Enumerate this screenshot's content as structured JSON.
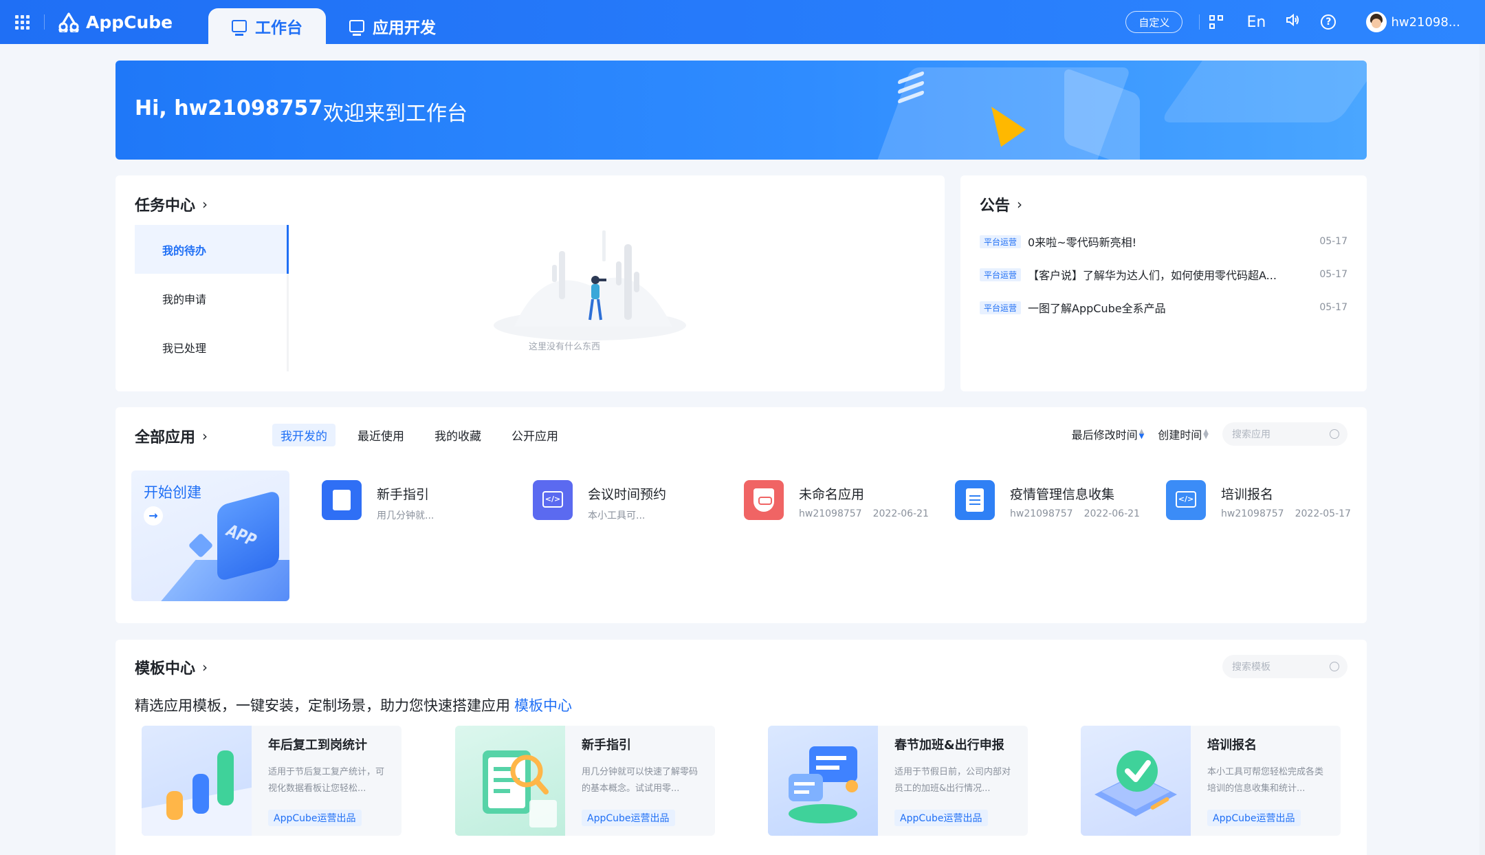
{
  "app": {
    "brand": "AppCube",
    "tabs": [
      {
        "label": "工作台",
        "active": true
      },
      {
        "label": "应用开发",
        "active": false
      }
    ],
    "customize_label": "自定义",
    "lang_label": "En",
    "user_name": "hw21098..."
  },
  "banner": {
    "greeting": "Hi, hw21098757",
    "welcome": "欢迎来到工作台"
  },
  "tasks": {
    "title": "任务中心",
    "nav": [
      "我的待办",
      "我的申请",
      "我已处理"
    ],
    "empty_text": "这里没有什么东西"
  },
  "notices": {
    "title": "公告",
    "items": [
      {
        "tag": "平台运营",
        "text": "0来啦~零代码新亮相!",
        "date": "05-17"
      },
      {
        "tag": "平台运营",
        "text": "【客户说】了解华为达人们，如何使用零代码超A...",
        "date": "05-17"
      },
      {
        "tag": "平台运营",
        "text": "一图了解AppCube全系产品",
        "date": "05-17"
      }
    ]
  },
  "apps": {
    "title": "全部应用",
    "tabs": [
      "我开发的",
      "最近使用",
      "我的收藏",
      "公开应用"
    ],
    "sort_modified": "最后修改时间",
    "sort_created": "创建时间",
    "search_placeholder": "搜索应用",
    "create_label": "开始创建",
    "create_deco_text": "APP",
    "items": [
      {
        "name": "新手指引",
        "sub1": "用几分钟就...",
        "sub2": "",
        "color": "#2f6ff5",
        "icon": "book-icon"
      },
      {
        "name": "会议时间预约",
        "sub1": "本小工具可...",
        "sub2": "",
        "color": "#5b6af0",
        "icon": "code-icon"
      },
      {
        "name": "未命名应用",
        "sub1": "hw21098757",
        "sub2": "2022-06-21",
        "color": "#f06464",
        "icon": "shield-icon"
      },
      {
        "name": "疫情管理信息收集",
        "sub1": "hw21098757",
        "sub2": "2022-06-21",
        "color": "#2f80f5",
        "icon": "document-icon"
      },
      {
        "name": "培训报名",
        "sub1": "hw21098757",
        "sub2": "2022-05-17",
        "color": "#3b8cf7",
        "icon": "code-icon"
      }
    ]
  },
  "templates": {
    "title": "模板中心",
    "search_placeholder": "搜索模板",
    "desc": "精选应用模板，一键安装，定制场景，助力您快速搭建应用",
    "desc_link": "模板中心",
    "items": [
      {
        "name": "年后复工到岗统计",
        "text": "适用于节后复工复产统计，可视化数据看板让您轻松...",
        "tag": "AppCube运营出品"
      },
      {
        "name": "新手指引",
        "text": "用几分钟就可以快速了解零码的基本概念。试试用零...",
        "tag": "AppCube运营出品"
      },
      {
        "name": "春节加班&出行申报",
        "text": "适用于节假日前，公司内部对员工的加班&出行情况...",
        "tag": "AppCube运营出品"
      },
      {
        "name": "培训报名",
        "text": "本小工具可帮您轻松完成各类培训的信息收集和统计...",
        "tag": "AppCube运营出品"
      }
    ]
  }
}
